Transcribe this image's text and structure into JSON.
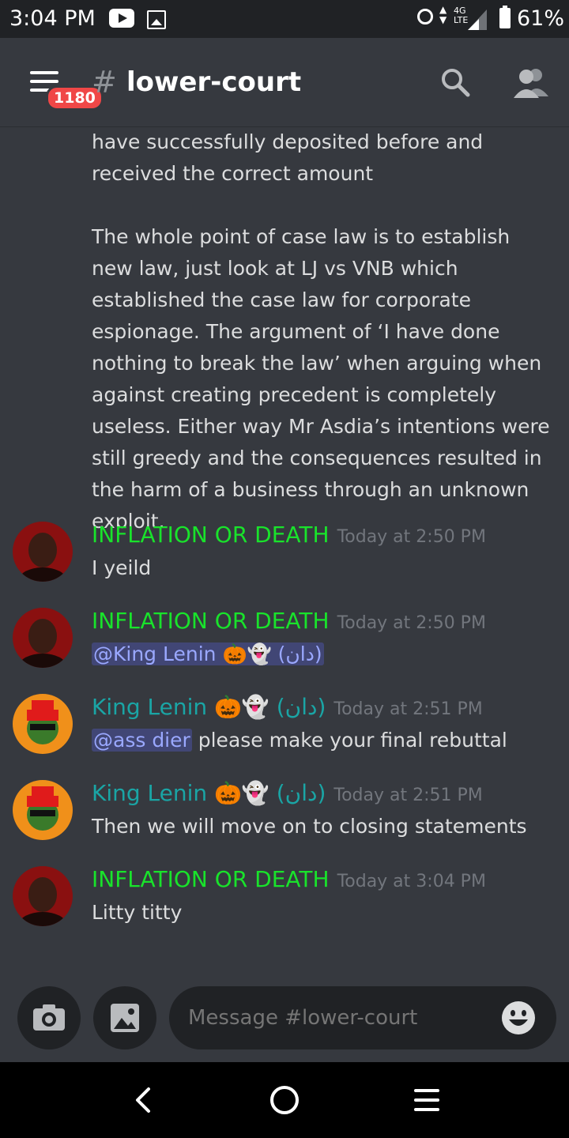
{
  "status_bar": {
    "time": "3:04 PM",
    "network": "4G\nLTE",
    "battery": "61%"
  },
  "header": {
    "badge": "1180",
    "hash": "#",
    "channel": "lower-court"
  },
  "continued_message": {
    "para1": "have successfully deposited before and received the correct amount",
    "para2": "The whole point of case law is to establish new law, just look at LJ vs VNB which established the case law for corporate espionage. The argument of ‘I have done nothing to break the law’ when arguing when against creating precedent is completely useless. Either way Mr Asdia’s intentions were still greedy and the consequences resulted in the harm of a business through an unknown exploit."
  },
  "messages": [
    {
      "author": "INFLATION OR DEATH",
      "time": "Today at 2:50 PM",
      "text": "I yeild"
    },
    {
      "author": "INFLATION OR DEATH",
      "time": "Today at 2:50 PM",
      "mention": "@King Lenin 🎃👻 (دان)"
    },
    {
      "author": "King Lenin 🎃👻 (دان)",
      "time": "Today at 2:51 PM",
      "mention": "@ass dier",
      "text": " please make your final rebuttal"
    },
    {
      "author": "King Lenin 🎃👻 (دان)",
      "time": "Today at 2:51 PM",
      "text": "Then we will move on to closing statements"
    },
    {
      "author": "INFLATION OR DEATH",
      "time": "Today at 3:04 PM",
      "text": "Litty titty"
    }
  ],
  "input": {
    "placeholder": "Message #lower-court"
  },
  "colors": {
    "author_inflation": "#19e32b",
    "author_lenin": "#1aa5a5",
    "mention_bg": "#414675"
  }
}
